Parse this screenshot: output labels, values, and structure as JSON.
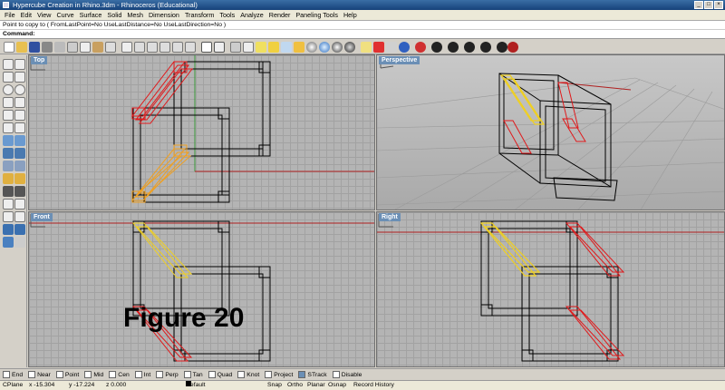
{
  "window": {
    "title": "Hypercube Creation in Rhino.3dm - Rhinoceros (Educational)"
  },
  "menu": [
    "File",
    "Edit",
    "View",
    "Curve",
    "Surface",
    "Solid",
    "Mesh",
    "Dimension",
    "Transform",
    "Tools",
    "Analyze",
    "Render",
    "Paneling Tools",
    "Help"
  ],
  "command": {
    "history": "Point to copy to ( FromLastPoint=No  UseLastDistance=No  UseLastDirection=No )",
    "prompt": "Command:",
    "input": ""
  },
  "viewports": {
    "top": "Top",
    "perspective": "Perspective",
    "front": "Front",
    "right": "Right"
  },
  "figure_label": "Figure 20",
  "osnaps": [
    "End",
    "Near",
    "Point",
    "Mid",
    "Cen",
    "Int",
    "Perp",
    "Tan",
    "Quad",
    "Knot",
    "Project",
    "STrack",
    "Disable"
  ],
  "status": {
    "cplane": "CPlane",
    "x": "x -15.304",
    "y": "y -17.224",
    "z": "z 0.000",
    "layer": "Default",
    "snap": "Snap",
    "ortho": "Ortho",
    "planar": "Planar",
    "osnap": "Osnap",
    "record": "Record History"
  },
  "colors": {
    "viewport_bg": "#b4b4b4",
    "selected_red": "#e0191b",
    "highlight_yellow": "#f0d020",
    "orange": "#f0a020",
    "label_blue": "#6b8fb5"
  }
}
